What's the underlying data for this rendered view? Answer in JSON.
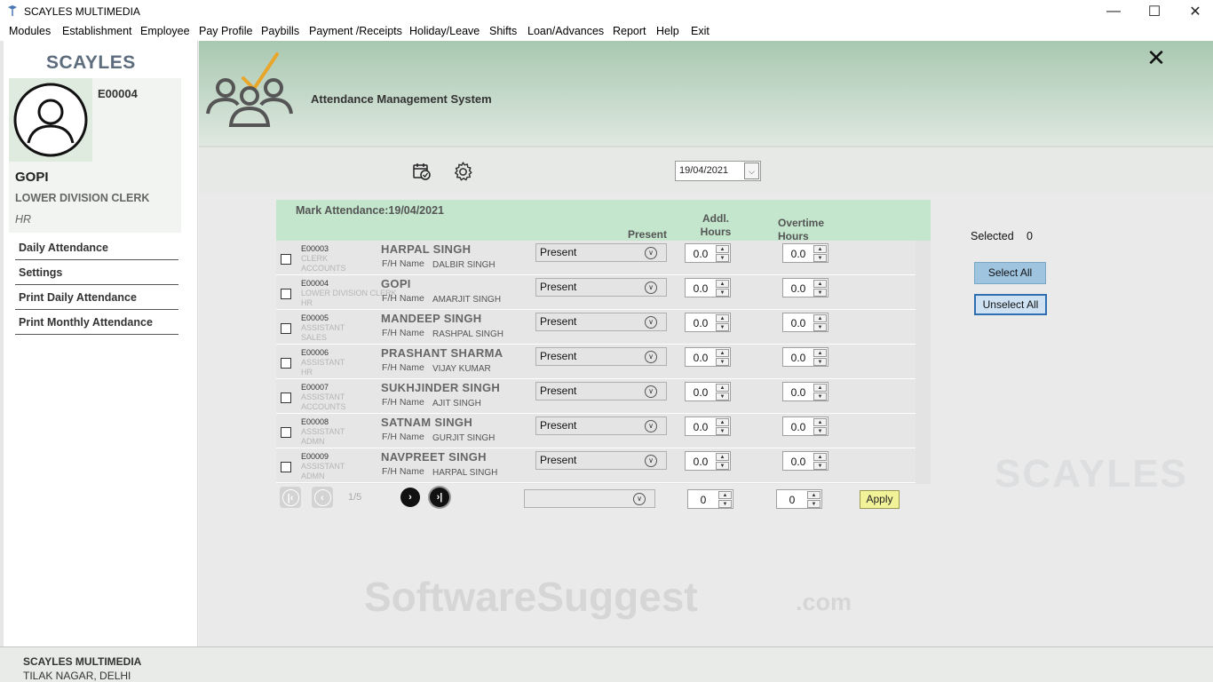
{
  "window": {
    "title": "SCAYLES MULTIMEDIA",
    "minimize": "—",
    "maximize": "☐",
    "close": "✕"
  },
  "menu": [
    "Modules",
    "Establishment",
    "Employee",
    "Pay Profile",
    "Paybills",
    "Payment /Receipts",
    "Holiday/Leave",
    "Shifts",
    "Loan/Advances",
    "Report",
    "Help",
    "Exit"
  ],
  "sidebar": {
    "logo": "SCAYLES",
    "employee": {
      "id": "E00004",
      "name": "GOPI",
      "designation": "LOWER DIVISION CLERK",
      "department": "HR"
    },
    "links": [
      "Daily Attendance",
      "Settings",
      "Print Daily Attendance",
      "Print Monthly Attendance"
    ]
  },
  "header": {
    "title": "Attendance Management System",
    "close": "✕"
  },
  "toolbar": {
    "date": "19/04/2021"
  },
  "attendance": {
    "title": "Mark Attendance:19/04/2021",
    "columns": {
      "present": "Present",
      "addl_hours": "Addl. Hours",
      "overtime_hours": "Overtime Hours"
    },
    "fh_label": "F/H Name",
    "rows": [
      {
        "id": "E00003",
        "designation": "CLERK",
        "department": "ACCOUNTS",
        "name": "HARPAL SINGH",
        "fh_name": "DALBIR SINGH",
        "status": "Present",
        "addl": "0.0",
        "overtime": "0.0"
      },
      {
        "id": "E00004",
        "designation": "LOWER DIVISION CLERK",
        "department": "HR",
        "name": "GOPI",
        "fh_name": "AMARJIT SINGH",
        "status": "Present",
        "addl": "0.0",
        "overtime": "0.0"
      },
      {
        "id": "E00005",
        "designation": "ASSISTANT",
        "department": "SALES",
        "name": "MANDEEP SINGH",
        "fh_name": "RASHPAL SINGH",
        "status": "Present",
        "addl": "0.0",
        "overtime": "0.0"
      },
      {
        "id": "E00006",
        "designation": "ASSISTANT",
        "department": "HR",
        "name": "PRASHANT SHARMA",
        "fh_name": "VIJAY KUMAR",
        "status": "Present",
        "addl": "0.0",
        "overtime": "0.0"
      },
      {
        "id": "E00007",
        "designation": "ASSISTANT",
        "department": "ACCOUNTS",
        "name": "SUKHJINDER SINGH",
        "fh_name": "AJIT SINGH",
        "status": "Present",
        "addl": "0.0",
        "overtime": "0.0"
      },
      {
        "id": "E00008",
        "designation": "ASSISTANT",
        "department": "ADMN",
        "name": "SATNAM SINGH",
        "fh_name": "GURJIT SINGH",
        "status": "Present",
        "addl": "0.0",
        "overtime": "0.0"
      },
      {
        "id": "E00009",
        "designation": "ASSISTANT",
        "department": "ADMN",
        "name": "NAVPREET SINGH",
        "fh_name": "HARPAL SINGH",
        "status": "Present",
        "addl": "0.0",
        "overtime": "0.0"
      }
    ],
    "pager": {
      "page": "1/5",
      "bulk_addl": "0",
      "bulk_overtime": "0",
      "apply": "Apply"
    }
  },
  "selection": {
    "label": "Selected",
    "count": "0",
    "select_all": "Select All",
    "unselect_all": "Unselect All"
  },
  "watermarks": {
    "brand": "SCAYLES",
    "site": "SoftwareSuggest",
    "site_tld": ".com"
  },
  "footer": {
    "company": "SCAYLES MULTIMEDIA",
    "address": "TILAK NAGAR, DELHI"
  },
  "colors": {
    "header_green": "#a8c8b0",
    "table_head": "#c3e6cc",
    "accent_orange": "#e8a62a",
    "select_blue": "#9fc4df"
  }
}
